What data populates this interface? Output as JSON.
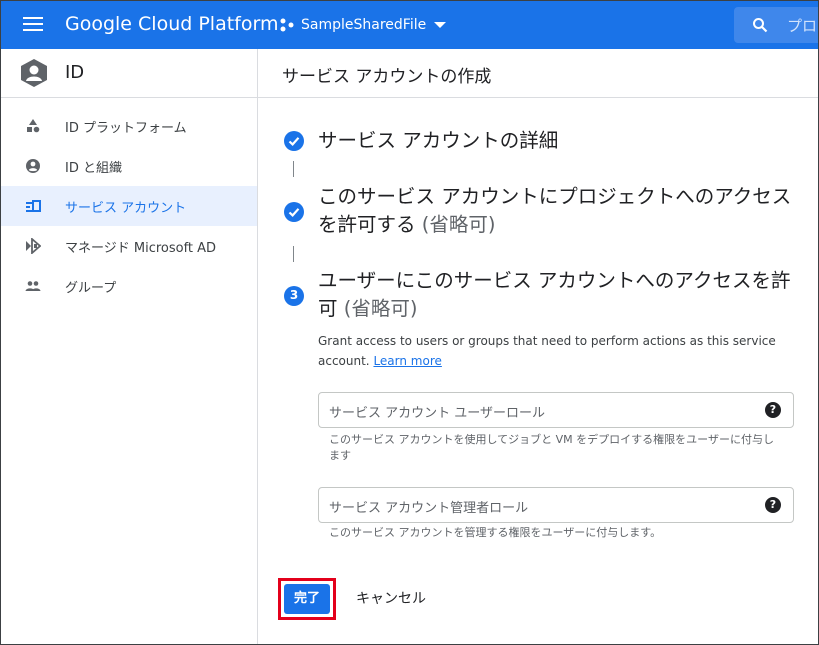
{
  "topbar": {
    "brand": "Google Cloud Platform",
    "project": "SampleSharedFile",
    "search_placeholder": "プロ"
  },
  "sidebar": {
    "title": "ID",
    "items": [
      {
        "label": "ID プラットフォーム",
        "icon": "id-platform-icon"
      },
      {
        "label": "ID と組織",
        "icon": "account-circle-icon"
      },
      {
        "label": "サービス アカウント",
        "icon": "service-account-icon",
        "active": true
      },
      {
        "label": "マネージド Microsoft AD",
        "icon": "managed-ad-icon"
      },
      {
        "label": "グループ",
        "icon": "group-icon"
      }
    ]
  },
  "main": {
    "title": "サービス アカウントの作成",
    "steps": [
      {
        "title": "サービス アカウントの詳細",
        "optional": "",
        "state": "done"
      },
      {
        "title": "このサービス アカウントにプロジェクトへのアクセスを許可する",
        "optional": "(省略可)",
        "state": "done"
      },
      {
        "number": "3",
        "title": "ユーザーにこのサービス アカウントへのアクセスを許可",
        "optional": "(省略可)",
        "state": "active"
      }
    ],
    "description": "Grant access to users or groups that need to perform actions as this service account.",
    "learn_more": "Learn more",
    "fields": [
      {
        "placeholder": "サービス アカウント ユーザーロール",
        "hint": "このサービス アカウントを使用してジョブと VM をデプロイする権限をユーザーに付与します"
      },
      {
        "placeholder": "サービス アカウント管理者ロール",
        "hint": "このサービス アカウントを管理する権限をユーザーに付与します。"
      }
    ],
    "help_glyph": "?",
    "done_label": "完了",
    "cancel_label": "キャンセル"
  },
  "colors": {
    "brand_blue": "#1a73e8",
    "highlight_red": "#e3001b",
    "active_nav_bg": "#e8f0fe"
  }
}
